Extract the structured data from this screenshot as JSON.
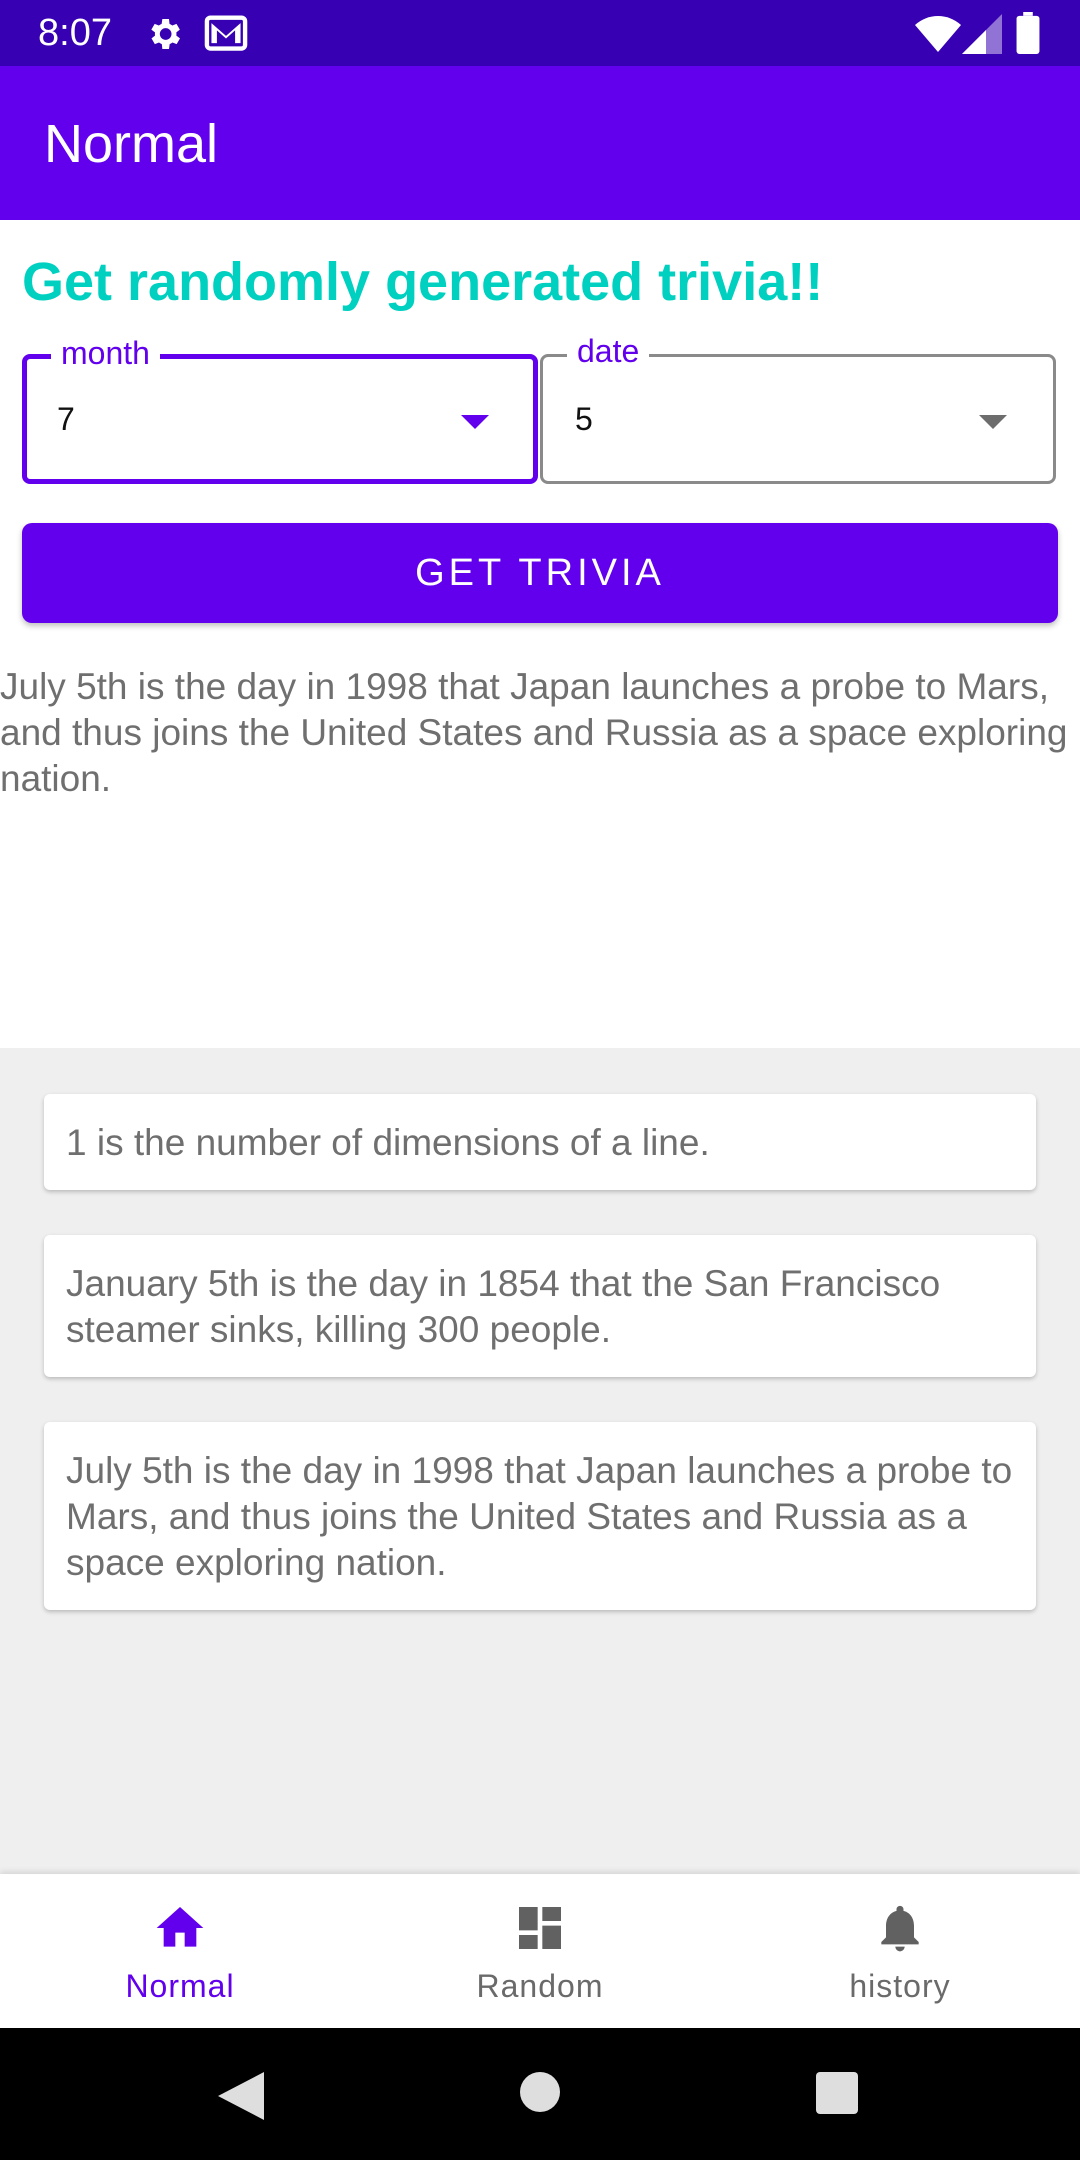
{
  "status_bar": {
    "time": "8:07",
    "icons": [
      "gear-icon",
      "mail-icon",
      "wifi-icon",
      "signal-icon",
      "battery-icon"
    ]
  },
  "app_bar": {
    "title": "Normal"
  },
  "main": {
    "headline": "Get randomly generated trivia!!",
    "month_dropdown": {
      "label": "month",
      "value": "7"
    },
    "date_dropdown": {
      "label": "date",
      "value": "5"
    },
    "get_trivia_button": "GET TRIVIA",
    "result_text": "July 5th is the day in 1998 that Japan launches a probe to Mars, and thus joins the United States and Russia as a space exploring nation."
  },
  "history_cards": [
    {
      "text": "1 is the number of dimensions of a line."
    },
    {
      "text": "January 5th is the day in 1854 that the San Francisco steamer sinks, killing 300 people."
    },
    {
      "text": "July 5th is the day in 1998 that Japan launches a probe to Mars, and thus joins the United States and Russia as a space exploring nation."
    }
  ],
  "bottom_nav": {
    "items": [
      {
        "label": "Normal",
        "icon": "home-icon",
        "selected": true
      },
      {
        "label": "Random",
        "icon": "dashboard-icon",
        "selected": false
      },
      {
        "label": "history",
        "icon": "bell-icon",
        "selected": false
      }
    ]
  },
  "colors": {
    "status_bar": "#3700b3",
    "primary": "#6200ee",
    "headline": "#00d0c0",
    "list_background": "#efefef"
  }
}
